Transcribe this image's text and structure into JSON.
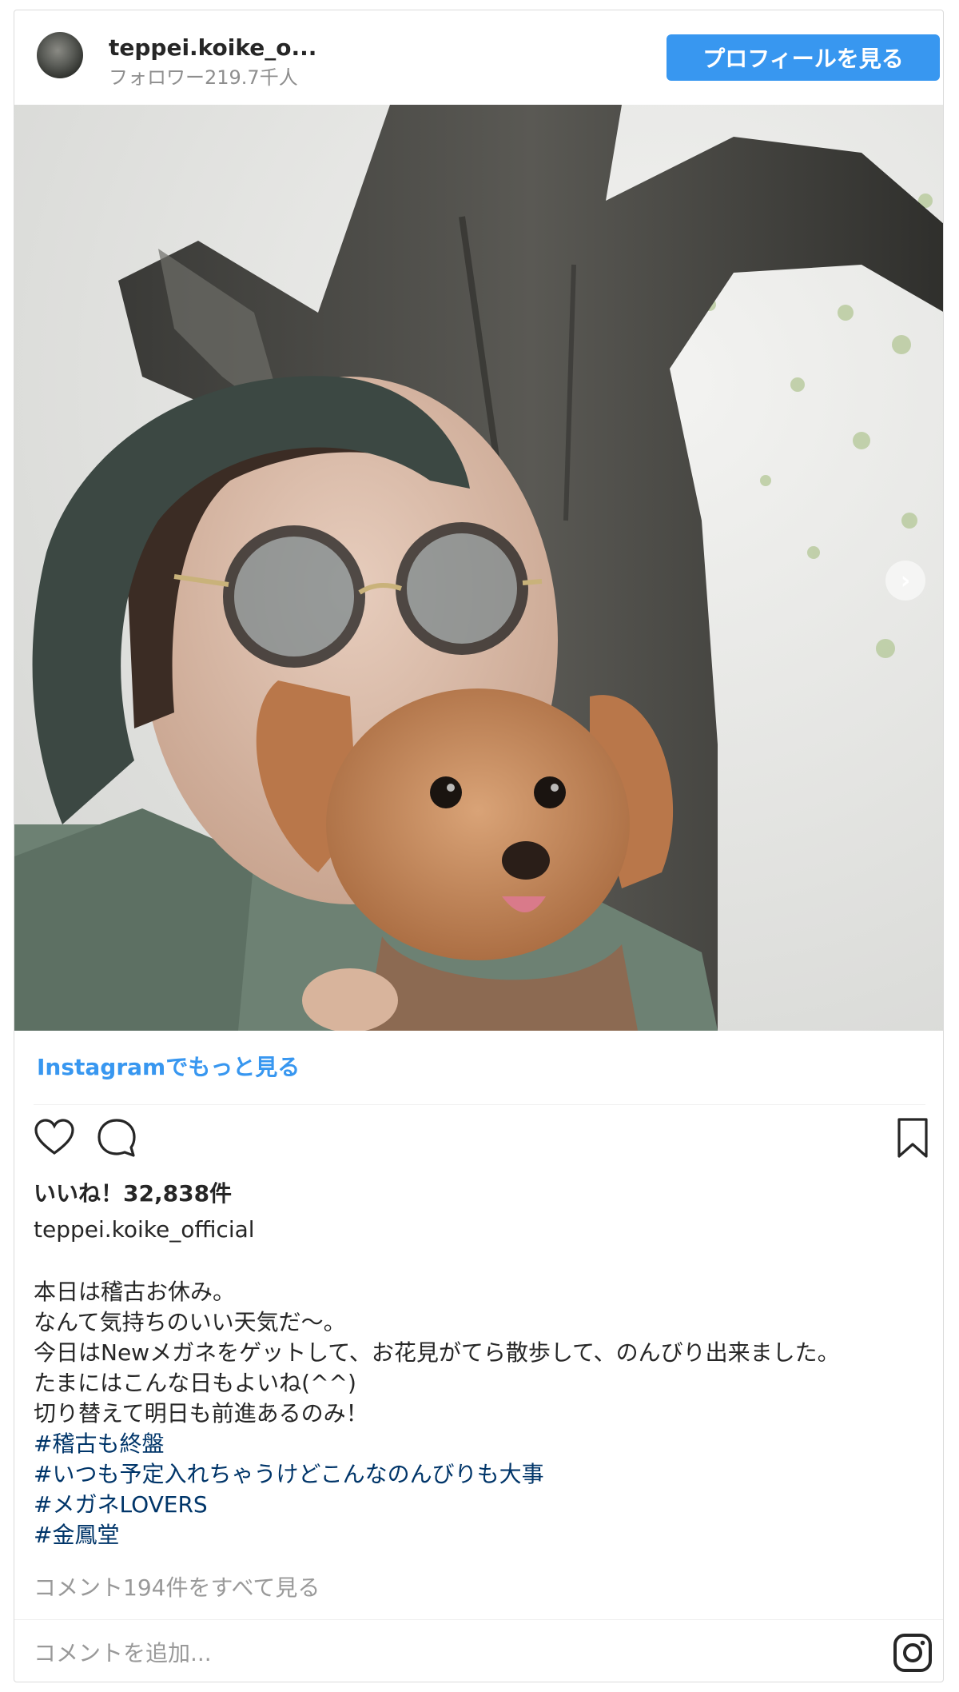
{
  "header": {
    "username": "teppei.koike_o...",
    "followers": "フォロワー219.7千人",
    "profile_button": "プロフィールを見る"
  },
  "more_link": "Instagramでもっと見る",
  "likes": "いいね！32,838件",
  "owner": "teppei.koike_official",
  "caption_lines": [
    "本日は稽古お休み。",
    "なんて気持ちのいい天気だ〜。",
    "今日はNewメガネをゲットして、お花見がてら散歩して、のんびり出来ました。",
    "たまにはこんな日もよいね(^^)",
    "切り替えて明日も前進あるのみ！"
  ],
  "hashtags": [
    "#稽古も終盤",
    "#いつも予定入れちゃうけどこんなのんびりも大事",
    "#メガネLOVERS",
    "#金鳳堂"
  ],
  "view_comments": "コメント194件をすべて見る",
  "add_comment_placeholder": "コメントを追加...",
  "icons": [
    "heart-icon",
    "comment-icon",
    "bookmark-icon",
    "instagram-icon",
    "chevron-right-icon"
  ],
  "colors": {
    "accent": "#3897f0",
    "hashtag": "#003569",
    "muted": "#8e8e8e"
  }
}
